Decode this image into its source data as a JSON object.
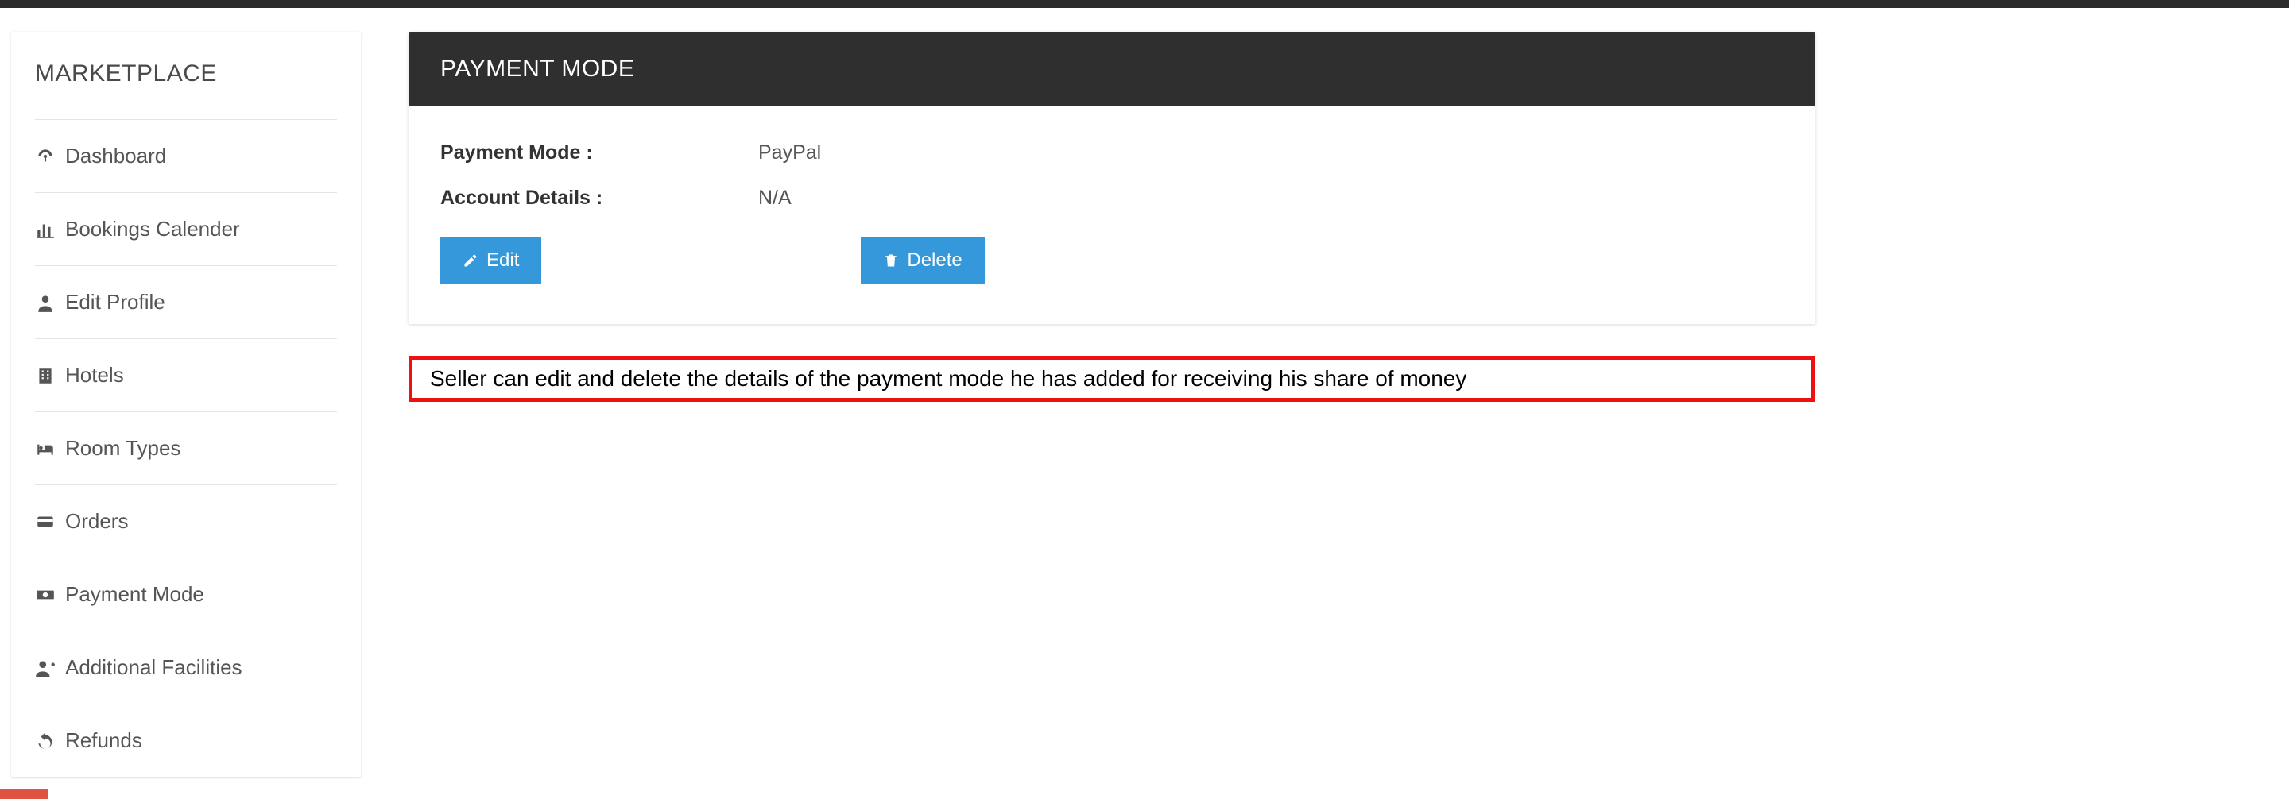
{
  "sidebar": {
    "title": "MARKETPLACE",
    "items": [
      {
        "label": "Dashboard"
      },
      {
        "label": "Bookings Calender"
      },
      {
        "label": "Edit Profile"
      },
      {
        "label": "Hotels"
      },
      {
        "label": "Room Types"
      },
      {
        "label": "Orders"
      },
      {
        "label": "Payment Mode"
      },
      {
        "label": "Additional Facilities"
      },
      {
        "label": "Refunds"
      }
    ]
  },
  "panel": {
    "title": "PAYMENT MODE",
    "rows": [
      {
        "label": "Payment Mode :",
        "value": "PayPal"
      },
      {
        "label": "Account Details :",
        "value": "N/A"
      }
    ],
    "actions": {
      "edit": "Edit",
      "delete": "Delete"
    }
  },
  "callout": "Seller can edit and delete the details of the payment mode he has added for receiving his share of money"
}
